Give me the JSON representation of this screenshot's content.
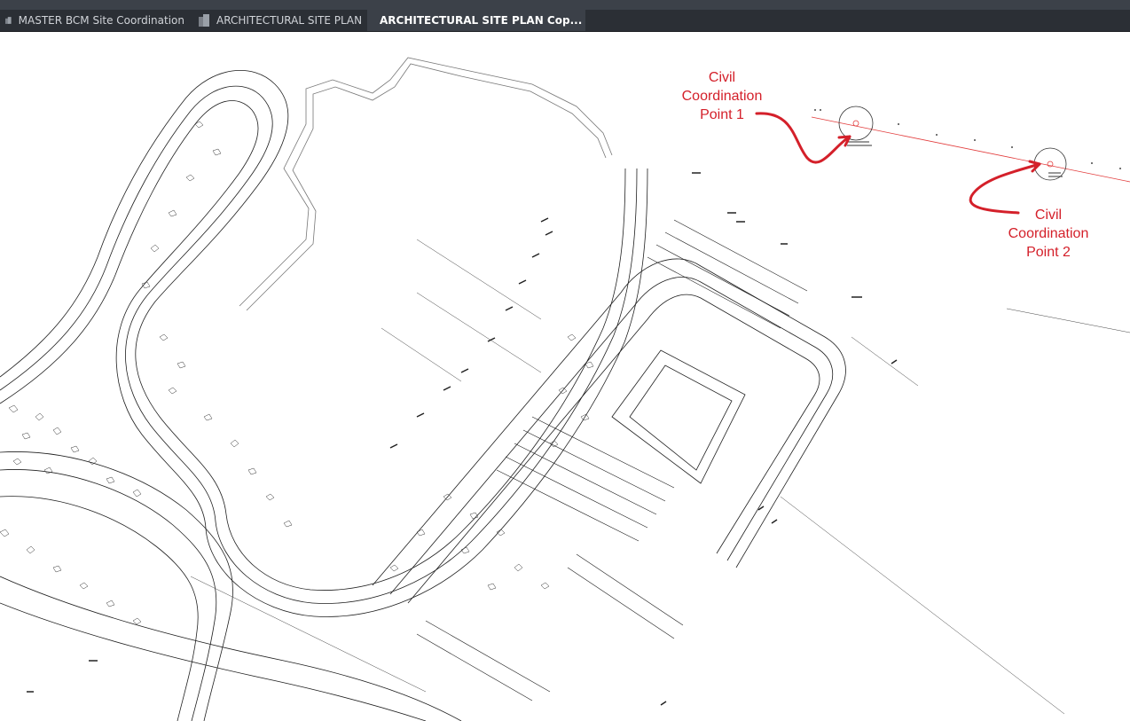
{
  "tabs": [
    {
      "label": "MASTER BCM Site Coordination",
      "active": false
    },
    {
      "label": "ARCHITECTURAL SITE PLAN",
      "active": false
    },
    {
      "label": "ARCHITECTURAL SITE PLAN Cop...",
      "active": true
    }
  ],
  "annotations": [
    {
      "lines": [
        "Civil",
        "Coordination",
        "Point 1"
      ]
    },
    {
      "lines": [
        "Civil",
        "Coordination",
        "Point 2"
      ]
    }
  ],
  "colors": {
    "annotation": "#d4202a",
    "tabbar": "#2b2f35",
    "active_tab": "#3b4048",
    "drawing_line": "#1a1a1a",
    "canvas": "#ffffff"
  },
  "icons": {
    "tab_document": "drawing-document-icon",
    "tab_close": "close-icon"
  }
}
